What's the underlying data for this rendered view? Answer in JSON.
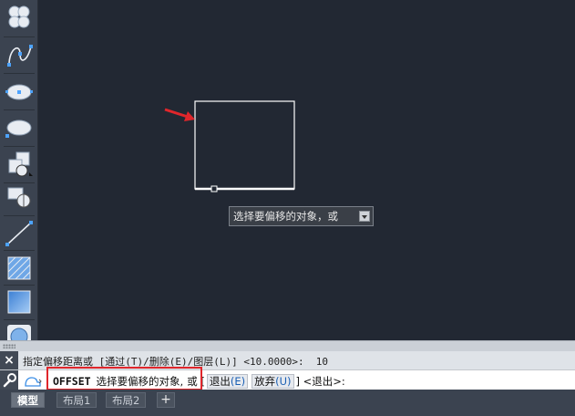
{
  "toolbar": {
    "tools": [
      "revision-cloud-icon",
      "spline-icon",
      "ellipse-icon",
      "ellipse-arc-icon",
      "insert-block-icon",
      "create-block-icon",
      "line-icon",
      "hatch-icon",
      "gradient-icon",
      "region-icon"
    ]
  },
  "tooltip": {
    "text": "选择要偏移的对象，或"
  },
  "history": {
    "close": "×",
    "text": "指定偏移距离或 [通过(T)/删除(E)/图层(L)] <10.0000>:  10"
  },
  "command": {
    "name": "OFFSET",
    "prompt": "选择要偏移的对象,",
    "or": "或 [",
    "options": [
      {
        "label": "退出",
        "key": "(E)"
      },
      {
        "label": "放弃",
        "key": "(U)"
      }
    ],
    "suffix": "] <退出>:"
  },
  "tabs": [
    "模型",
    "布局1",
    "布局2"
  ],
  "tabs_add": "+",
  "colors": {
    "canvas": "#222833",
    "highlight": "#e0262b",
    "arrow": "#e0262b"
  }
}
